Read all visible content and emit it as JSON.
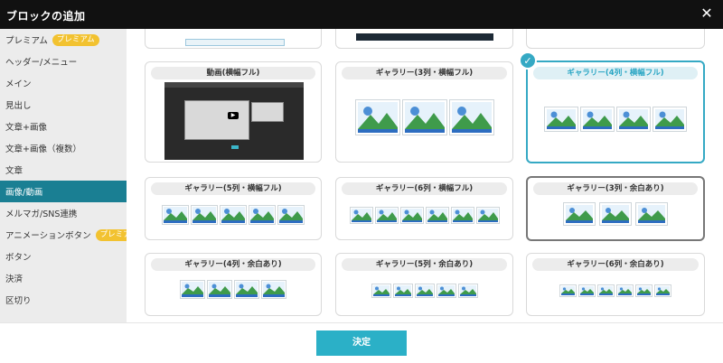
{
  "window": {
    "title": "ブロックの追加",
    "close_glyph": "✕"
  },
  "sidebar": {
    "items": [
      {
        "label": "プレミアム",
        "badge": "プレミアム"
      },
      {
        "label": "ヘッダー/メニュー"
      },
      {
        "label": "メイン"
      },
      {
        "label": "見出し"
      },
      {
        "label": "文章+画像"
      },
      {
        "label": "文章+画像（複数）"
      },
      {
        "label": "文章"
      },
      {
        "label": "画像/動画",
        "active": true
      },
      {
        "label": "メルマガ/SNS連携"
      },
      {
        "label": "アニメーションボタン",
        "badge": "プレミアム"
      },
      {
        "label": "ボタン"
      },
      {
        "label": "決済"
      },
      {
        "label": "区切り"
      }
    ]
  },
  "cards": {
    "video_full": "動画(横幅フル)",
    "gallery3_full": "ギャラリー(3列・横幅フル)",
    "gallery4_full": "ギャラリー(4列・横幅フル)",
    "gallery5_full": "ギャラリー(5列・横幅フル)",
    "gallery6_full": "ギャラリー(6列・横幅フル)",
    "gallery3_margin": "ギャラリー(3列・余白あり)",
    "gallery4_margin": "ギャラリー(4列・余白あり)",
    "gallery5_margin": "ギャラリー(5列・余白あり)",
    "gallery6_margin": "ギャラリー(6列・余白あり)"
  },
  "selected_card": "ギャラリー(4列・横幅フル)",
  "footer": {
    "decide_label": "決定"
  },
  "colors": {
    "accent": "#2bb0c7",
    "sidebar_active": "#1a7f93",
    "badge": "#f2c230",
    "selected_border": "#35a9c4"
  },
  "icons": {
    "close": "close-icon",
    "check": "check-icon",
    "thumbnail": "landscape-image-icon",
    "play": "play-icon"
  }
}
